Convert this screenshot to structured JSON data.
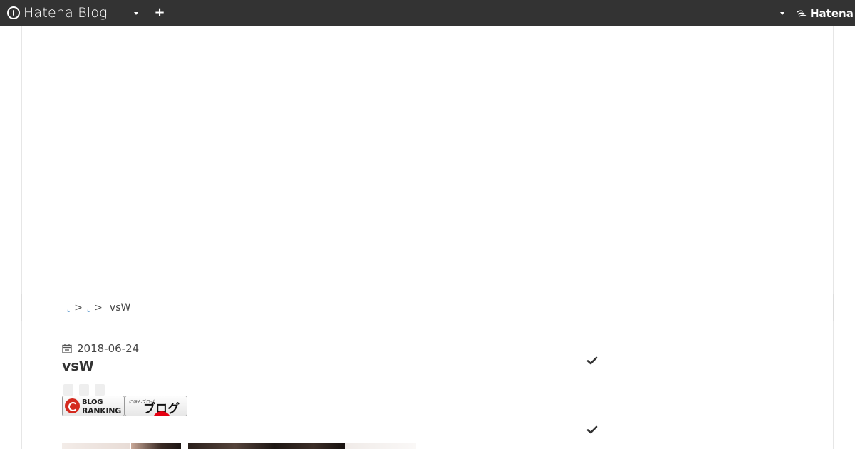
{
  "navbar": {
    "brand": "Hatena Blog",
    "right_logo": "Hatena",
    "icons": {
      "brand": "hatena-blog-logo-icon",
      "dropdown": "caret-down-icon",
      "add": "plus-icon",
      "hatena": "hatena-logo-icon"
    }
  },
  "breadcrumb": {
    "links": [
      "",
      ""
    ],
    "separator": ">",
    "current": "vsW"
  },
  "article": {
    "date": "2018-06-24",
    "title": "vsW",
    "share_buttons": 3,
    "banners": {
      "ranking": {
        "line1": "BLOG",
        "line2": "RANKING",
        "small": "人気ブログランキング"
      },
      "mura": {
        "small": "にほんブログ",
        "big": "ブログ村"
      }
    }
  },
  "sidebar": {
    "icons": [
      "check-icon",
      "check-icon"
    ]
  },
  "colors": {
    "navbar_bg": "#333333",
    "link": "#2f7bbf",
    "ranking_red": "#d42a1f",
    "mura_red": "#e60012"
  }
}
